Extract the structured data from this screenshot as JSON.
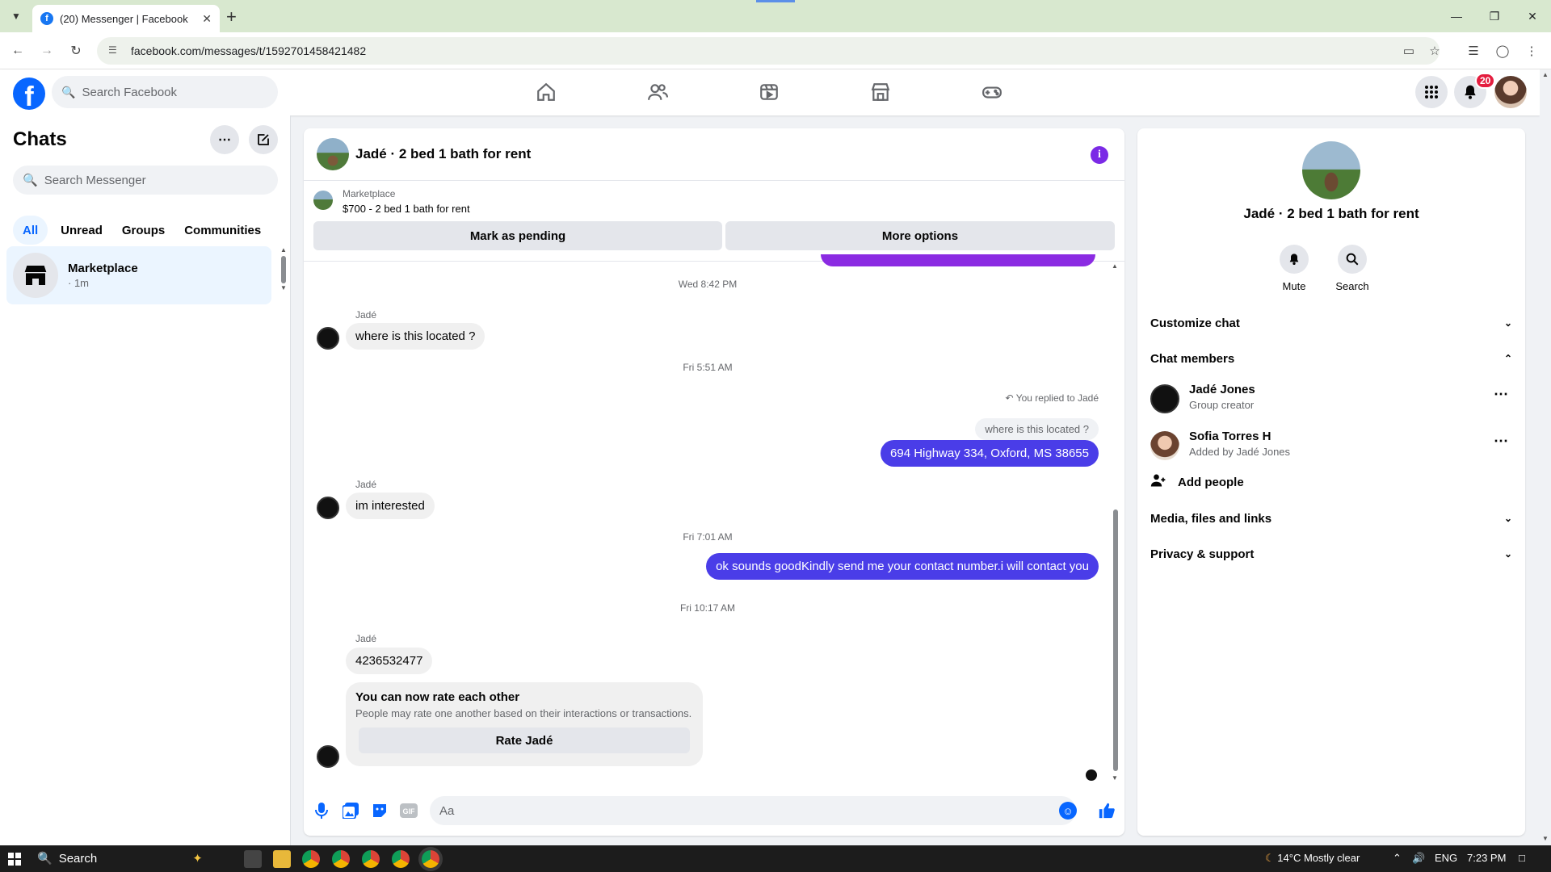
{
  "browser": {
    "tab_title": "(20) Messenger | Facebook",
    "tab_favicon": "f",
    "url": "facebook.com/messages/t/1592701458421482"
  },
  "fb": {
    "search_placeholder": "Search Facebook",
    "notification_count": "20",
    "brand_color": "#0866ff"
  },
  "sidebar": {
    "title": "Chats",
    "search_placeholder": "Search Messenger",
    "filters": [
      "All",
      "Unread",
      "Groups",
      "Communities"
    ],
    "active_filter": "All",
    "chats": [
      {
        "name": "Marketplace",
        "sub": "· 1m"
      }
    ]
  },
  "conversation": {
    "title": "Jadé · 2 bed 1 bath for rent",
    "marketplace_label": "Marketplace",
    "listing": "$700 - 2 bed 1 bath for rent",
    "mark_pending": "Mark as pending",
    "more_options": "More options",
    "timestamps": [
      "Wed 8:42 PM",
      "Fri 5:51 AM",
      "Fri 7:01 AM",
      "Fri 10:17 AM"
    ],
    "sender_name": "Jadé",
    "messages": {
      "m1": "where is this located ?",
      "reply_label": "You replied to Jadé",
      "reply_quote": "where is this located ?",
      "m2": "694 Highway 334, Oxford, MS 38655",
      "m3": "im interested",
      "m4": "ok sounds goodKindly send me your contact number.i will contact you",
      "m5": "4236532477"
    },
    "rate_card": {
      "heading": "You can now rate each other",
      "desc": "People may rate one another based on their interactions or transactions.",
      "button": "Rate Jadé"
    },
    "composer_placeholder": "Aa",
    "outgoing_color": "#4a3de8"
  },
  "right_panel": {
    "name": "Jadé · 2 bed 1 bath for rent",
    "mute_label": "Mute",
    "search_label": "Search",
    "customize_chat": "Customize chat",
    "chat_members": "Chat members",
    "members": [
      {
        "name": "Jadé Jones",
        "role": "Group creator"
      },
      {
        "name": "Sofia Torres H",
        "role": "Added by Jadé Jones"
      }
    ],
    "add_people": "Add people",
    "media_files_links": "Media, files and links",
    "privacy_support": "Privacy & support"
  },
  "taskbar": {
    "search": "Search",
    "weather": "14°C  Mostly clear",
    "lang": "ENG",
    "time": "7:23 PM"
  }
}
